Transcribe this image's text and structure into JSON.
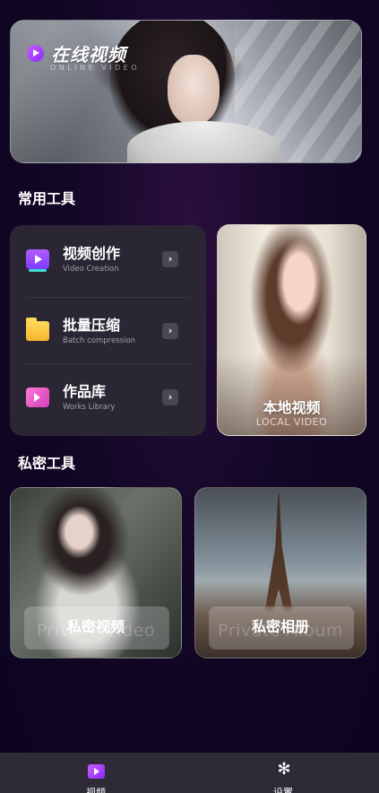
{
  "banner": {
    "title": "在线视频",
    "subtitle": "ONLINE VIDEO",
    "icon": "play-icon"
  },
  "common_tools": {
    "section_title": "常用工具",
    "items": [
      {
        "label": "视频创作",
        "sublabel": "Video Creation",
        "icon": "video-creation-icon",
        "arrow": "›"
      },
      {
        "label": "批量压缩",
        "sublabel": "Batch compression",
        "icon": "folder-icon",
        "arrow": "›"
      },
      {
        "label": "作品库",
        "sublabel": "Works Library",
        "icon": "works-library-icon",
        "arrow": "›"
      }
    ],
    "local_video": {
      "title": "本地视频",
      "subtitle": "LOCAL VIDEO"
    }
  },
  "private_tools": {
    "section_title": "私密工具",
    "cards": [
      {
        "title": "私密视频",
        "ghost": "Private Video"
      },
      {
        "title": "私密相册",
        "ghost": "Private Album"
      }
    ]
  },
  "bottom_nav": {
    "items": [
      {
        "label": "视频",
        "icon": "video-icon"
      },
      {
        "label": "设置",
        "icon": "gear-icon"
      }
    ]
  },
  "colors": {
    "background": "#130726",
    "card": "#2a2633",
    "accent": "#8a2bff",
    "nav": "#2e2b36"
  }
}
